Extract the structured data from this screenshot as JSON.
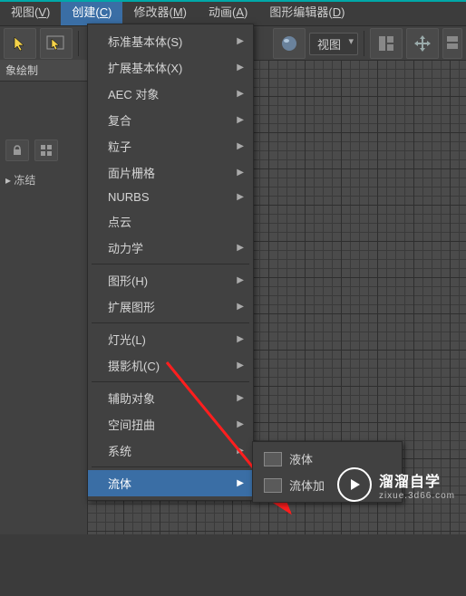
{
  "menubar": {
    "items": [
      {
        "label": "视图",
        "key": "V"
      },
      {
        "label": "创建",
        "key": "C"
      },
      {
        "label": "修改器",
        "key": "M"
      },
      {
        "label": "动画",
        "key": "A"
      },
      {
        "label": "图形编辑器",
        "key": "D"
      }
    ],
    "active_index": 1
  },
  "toolbar": {
    "viewport_label": "视图"
  },
  "leftpanel": {
    "header": "象绘制",
    "list_item": "冻结"
  },
  "create_menu": [
    {
      "label": "标准基本体(S)",
      "arrow": true
    },
    {
      "label": "扩展基本体(X)",
      "arrow": true
    },
    {
      "label": "AEC 对象",
      "arrow": true
    },
    {
      "label": "复合",
      "arrow": true
    },
    {
      "label": "粒子",
      "arrow": true
    },
    {
      "label": "面片栅格",
      "arrow": true
    },
    {
      "label": "NURBS",
      "arrow": true
    },
    {
      "label": "点云",
      "arrow": false
    },
    {
      "label": "动力学",
      "arrow": true
    },
    {
      "sep": true
    },
    {
      "label": "图形(H)",
      "arrow": true
    },
    {
      "label": "扩展图形",
      "arrow": true
    },
    {
      "sep": true
    },
    {
      "label": "灯光(L)",
      "arrow": true
    },
    {
      "label": "摄影机(C)",
      "arrow": true
    },
    {
      "sep": true
    },
    {
      "label": "辅助对象",
      "arrow": true
    },
    {
      "label": "空间扭曲",
      "arrow": true
    },
    {
      "label": "系统",
      "arrow": true
    },
    {
      "sep": true
    },
    {
      "label": "流体",
      "arrow": true,
      "active": true
    }
  ],
  "submenu": [
    {
      "label": "液体"
    },
    {
      "label": "流体加"
    }
  ],
  "watermark": {
    "title": "溜溜自学",
    "sub": "zixue.3d66.com"
  }
}
